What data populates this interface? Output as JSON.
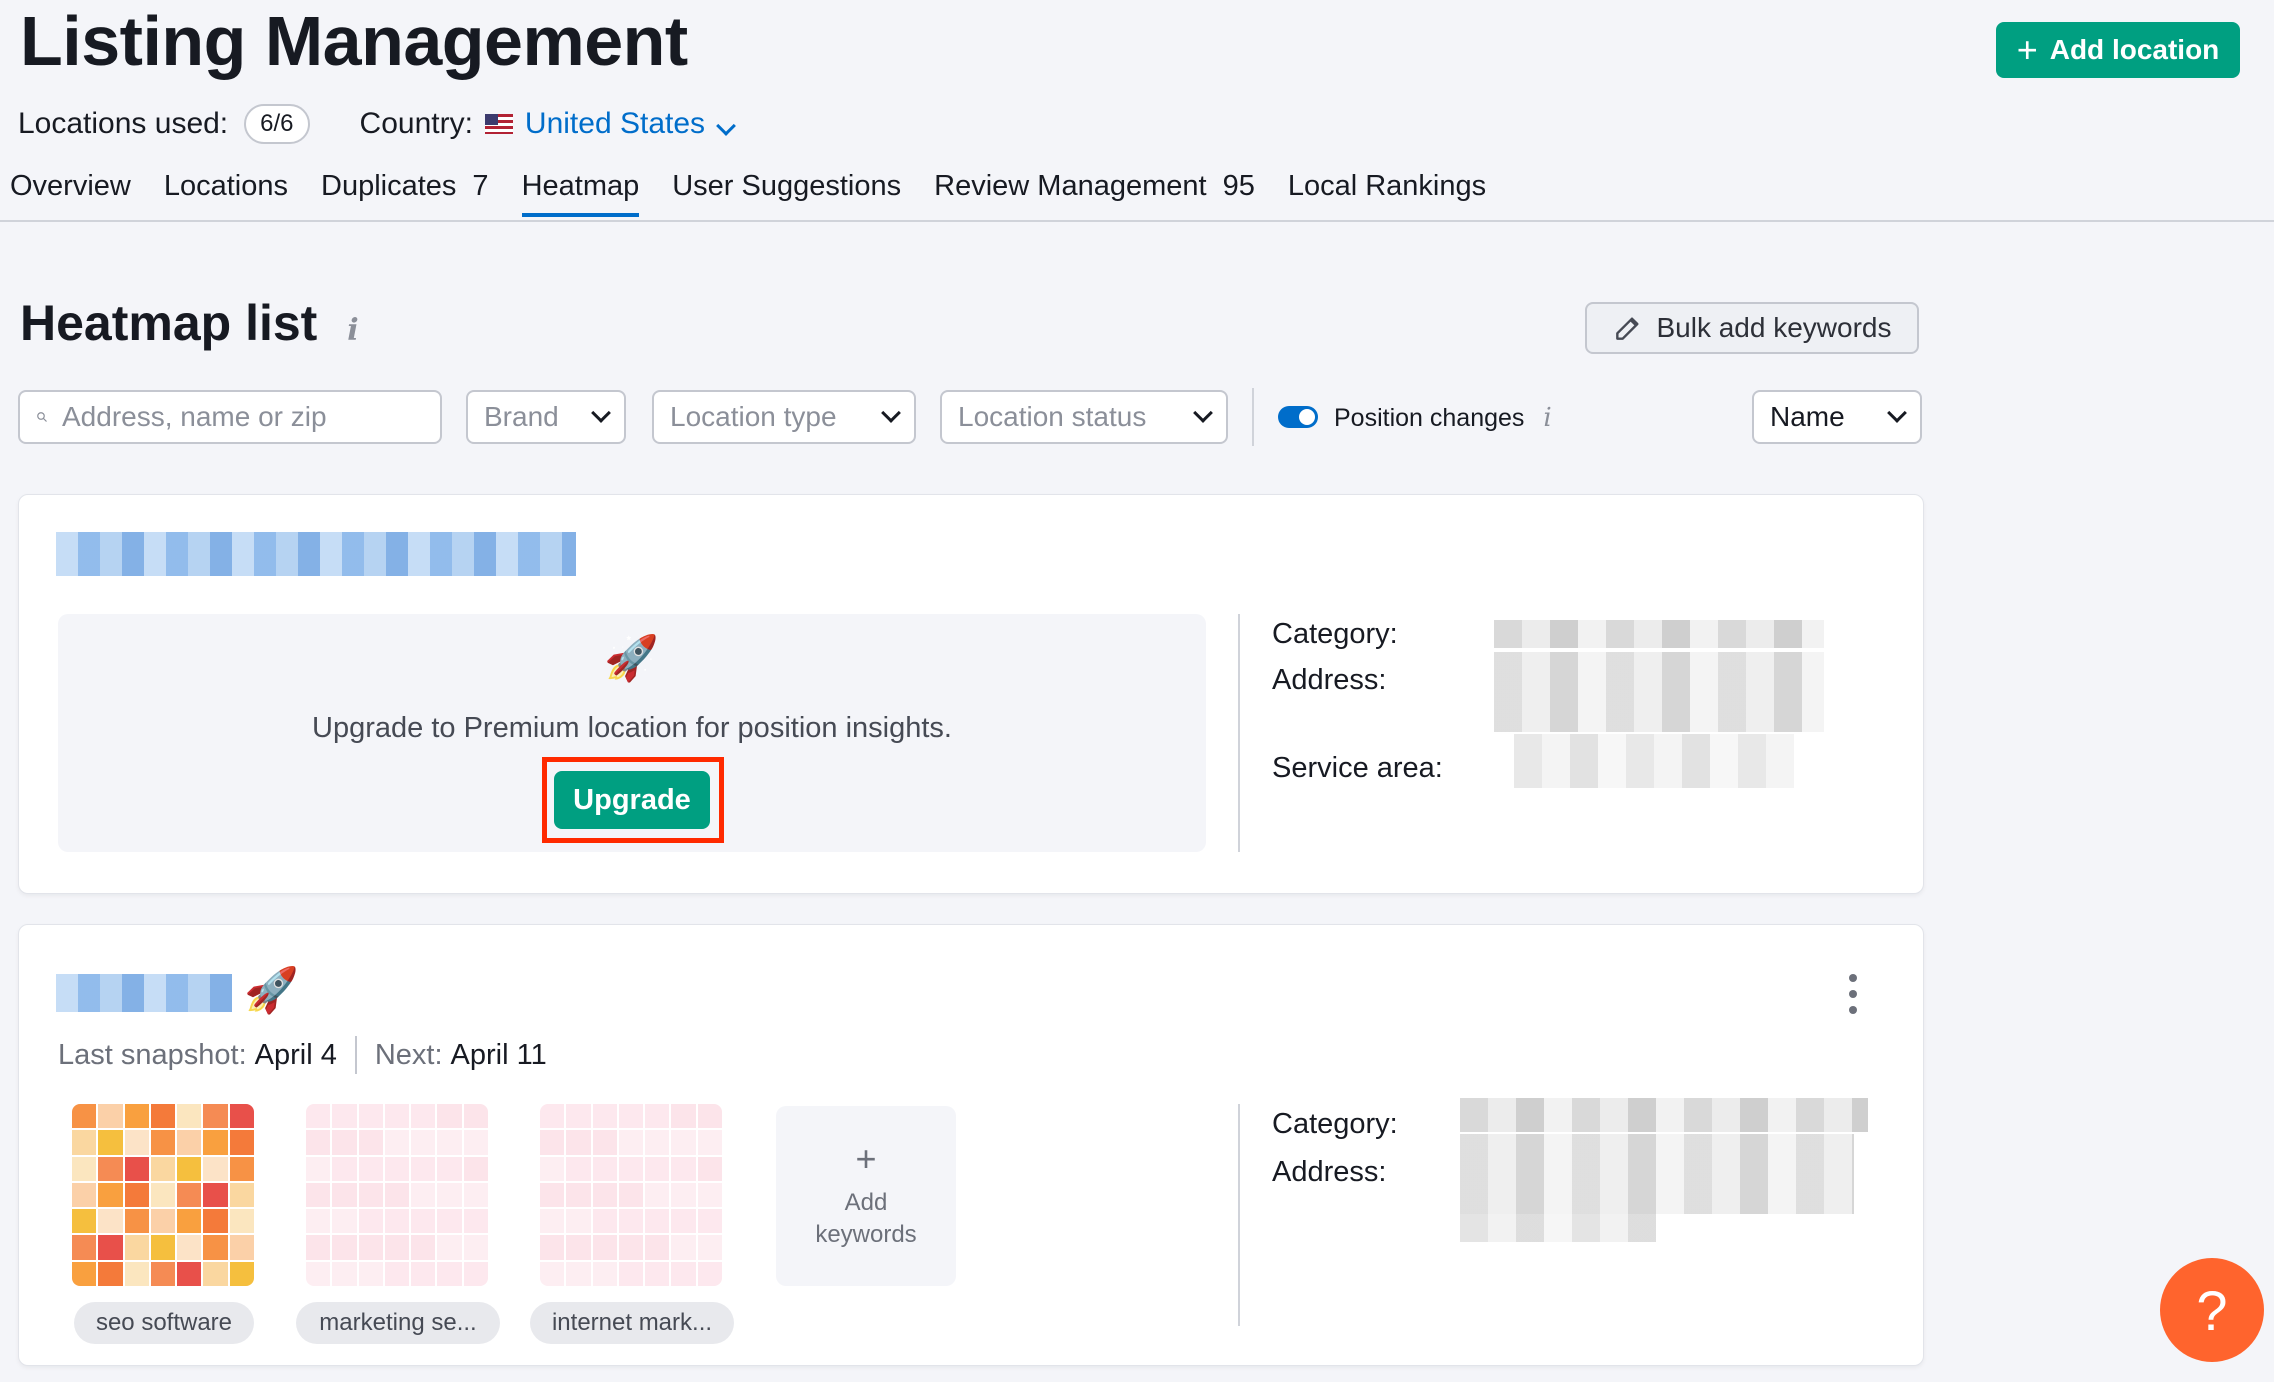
{
  "header": {
    "title": "Listing Management",
    "add_location_label": "Add location",
    "locations_used_label": "Locations used:",
    "locations_used_value": "6/6",
    "country_label": "Country:",
    "country_value": "United States"
  },
  "tabs": [
    {
      "label": "Overview",
      "count": ""
    },
    {
      "label": "Locations",
      "count": ""
    },
    {
      "label": "Duplicates",
      "count": "7"
    },
    {
      "label": "Heatmap",
      "count": "",
      "active": true
    },
    {
      "label": "User Suggestions",
      "count": ""
    },
    {
      "label": "Review Management",
      "count": "95"
    },
    {
      "label": "Local Rankings",
      "count": ""
    }
  ],
  "heatmap": {
    "title": "Heatmap list",
    "bulk_add_label": "Bulk add keywords",
    "search_placeholder": "Address, name or zip",
    "brand_filter": "Brand",
    "location_type_filter": "Location type",
    "location_status_filter": "Location status",
    "position_changes_label": "Position changes",
    "position_changes_on": true,
    "sort_value": "Name"
  },
  "card1": {
    "upsell_text": "Upgrade to Premium location for position insights.",
    "upgrade_label": "Upgrade",
    "category_label": "Category:",
    "address_label": "Address:",
    "service_area_label": "Service area:"
  },
  "card2": {
    "last_snapshot_label": "Last snapshot:",
    "last_snapshot_value": "April 4",
    "next_label": "Next:",
    "next_value": "April 11",
    "category_label": "Category:",
    "address_label": "Address:",
    "add_keywords_label": "Add keywords",
    "keywords": [
      {
        "label": "seo software"
      },
      {
        "label": "marketing se..."
      },
      {
        "label": "internet mark..."
      }
    ]
  },
  "colors": {
    "accent_green": "#009f81",
    "link_blue": "#006dca",
    "highlight_red": "#ff2a00",
    "help_orange": "#ff642d"
  },
  "icons": [
    "plus-icon",
    "chevron-down-icon",
    "us-flag-icon",
    "info-icon",
    "pencil-icon",
    "search-icon",
    "rocket-icon",
    "kebab-icon",
    "help-icon"
  ]
}
